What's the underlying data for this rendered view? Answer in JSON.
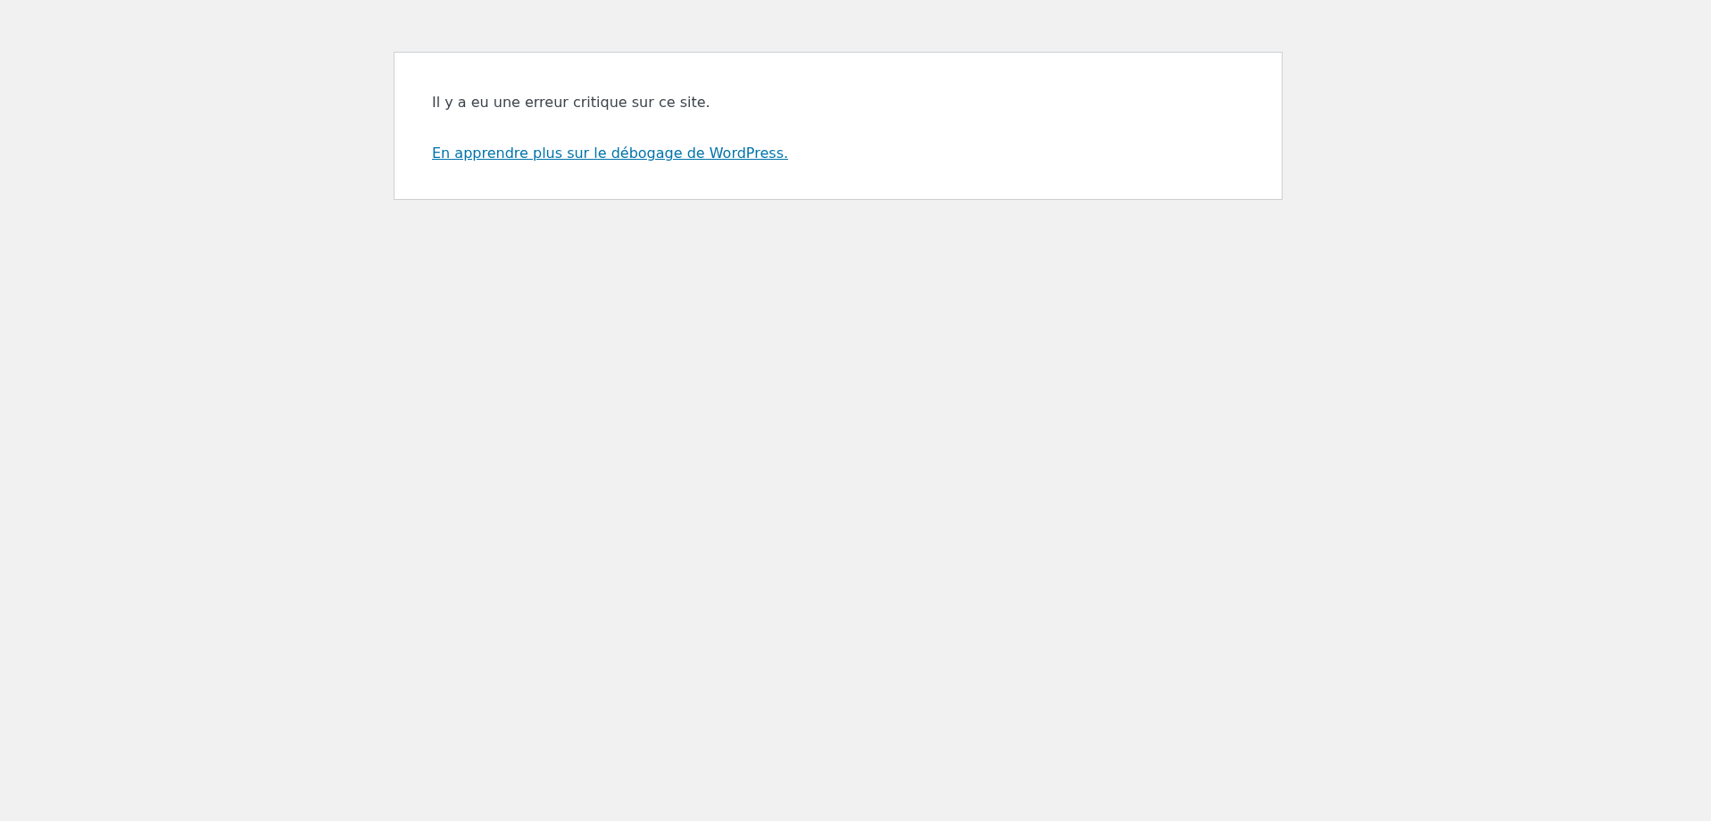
{
  "message": "Il y a eu une erreur critique sur ce site.",
  "link": "En apprendre plus sur le débogage de WordPress."
}
